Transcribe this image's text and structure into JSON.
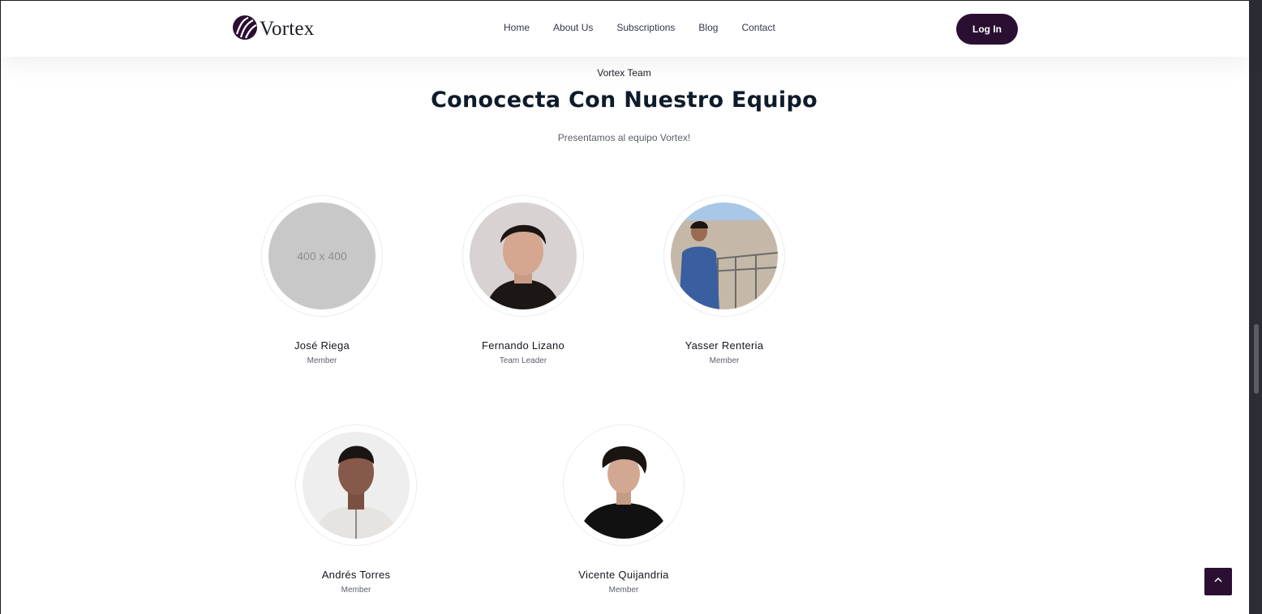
{
  "header": {
    "brand": "Vortex",
    "nav": [
      "Home",
      "About Us",
      "Subscriptions",
      "Blog",
      "Contact"
    ],
    "login_label": "Log In"
  },
  "section": {
    "eyebrow": "Vortex Team",
    "title": "Conocecta Con Nuestro Equipo",
    "subtitle": "Presentamos al equipo Vortex!"
  },
  "team": [
    {
      "name": "José Riega",
      "role": "Member",
      "placeholder_text": "400 x 400"
    },
    {
      "name": "Fernando Lizano",
      "role": "Team Leader"
    },
    {
      "name": "Yasser Renteria",
      "role": "Member"
    },
    {
      "name": "Andrés Torres",
      "role": "Member"
    },
    {
      "name": "Vicente Quijandria",
      "role": "Member"
    }
  ],
  "colors": {
    "brand_dark": "#2b0f33",
    "heading": "#0e1b2b",
    "placeholder_bg": "#c8c8c8"
  },
  "icons": {
    "logo": "vortex-swirl-icon",
    "scroll_top": "chevron-up-icon"
  }
}
